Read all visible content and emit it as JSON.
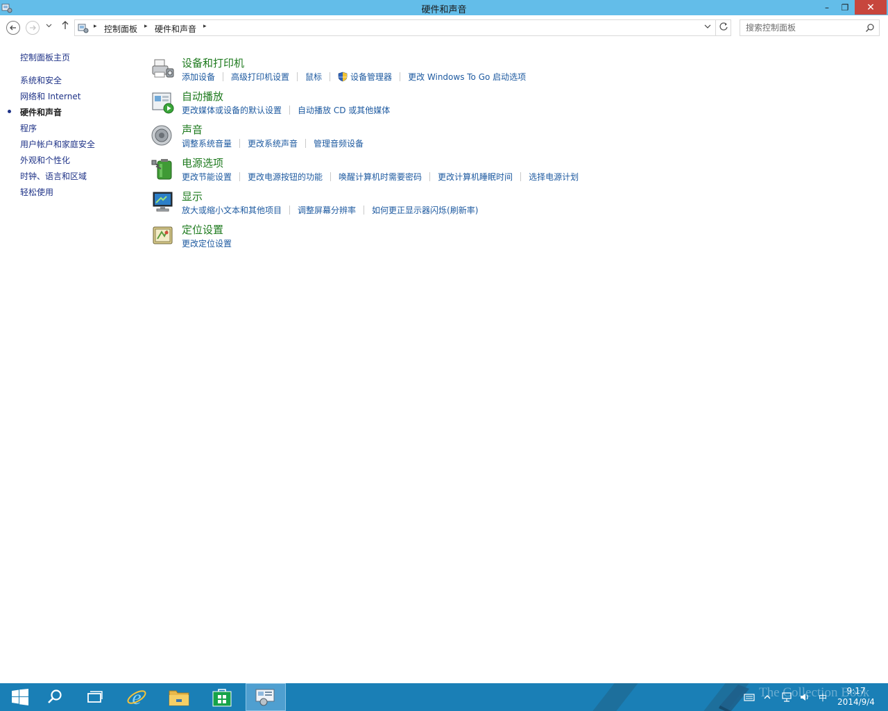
{
  "window": {
    "title": "硬件和声音",
    "minimize_glyph": "–",
    "maximize_glyph": "❐",
    "close_glyph": "✕"
  },
  "address": {
    "breadcrumbs": [
      "控制面板",
      "硬件和声音"
    ],
    "search_placeholder": "搜索控制面板"
  },
  "sidebar": {
    "items": [
      {
        "label": "控制面板主页",
        "current": false
      },
      {
        "label": "系统和安全",
        "current": false
      },
      {
        "label": "网络和 Internet",
        "current": false
      },
      {
        "label": "硬件和声音",
        "current": true
      },
      {
        "label": "程序",
        "current": false
      },
      {
        "label": "用户帐户和家庭安全",
        "current": false
      },
      {
        "label": "外观和个性化",
        "current": false
      },
      {
        "label": "时钟、语言和区域",
        "current": false
      },
      {
        "label": "轻松使用",
        "current": false
      }
    ]
  },
  "categories": [
    {
      "title": "设备和打印机",
      "icon": "printer-icon",
      "links": [
        "添加设备",
        "高级打印机设置",
        "鼠标",
        "设备管理器",
        "更改 Windows To Go 启动选项"
      ],
      "shield_link_index": 3
    },
    {
      "title": "自动播放",
      "icon": "autoplay-icon",
      "links": [
        "更改媒体或设备的默认设置",
        "自动播放 CD 或其他媒体"
      ]
    },
    {
      "title": "声音",
      "icon": "speaker-icon",
      "links": [
        "调整系统音量",
        "更改系统声音",
        "管理音频设备"
      ]
    },
    {
      "title": "电源选项",
      "icon": "battery-icon",
      "links": [
        "更改节能设置",
        "更改电源按钮的功能",
        "唤醒计算机时需要密码",
        "更改计算机睡眠时间",
        "选择电源计划"
      ]
    },
    {
      "title": "显示",
      "icon": "monitor-icon",
      "links": [
        "放大或缩小文本和其他项目",
        "调整屏幕分辨率",
        "如何更正显示器闪烁(刷新率)"
      ]
    },
    {
      "title": "定位设置",
      "icon": "location-icon",
      "links": [
        "更改定位设置"
      ]
    }
  ],
  "taskbar": {
    "apps": [
      "start-icon",
      "search-icon",
      "task-view-icon",
      "internet-explorer-icon",
      "file-explorer-icon",
      "store-icon",
      "control-panel-icon"
    ],
    "tray_input_indicator": "中",
    "time": "9:17",
    "date": "2014/9/4",
    "watermark": "The Collection Book"
  },
  "colors": {
    "titlebar": "#63bde9",
    "link": "#1e5aa0",
    "category_title": "#1e7a1e",
    "taskbar": "#1a7fb6",
    "close_button": "#c7463d"
  }
}
